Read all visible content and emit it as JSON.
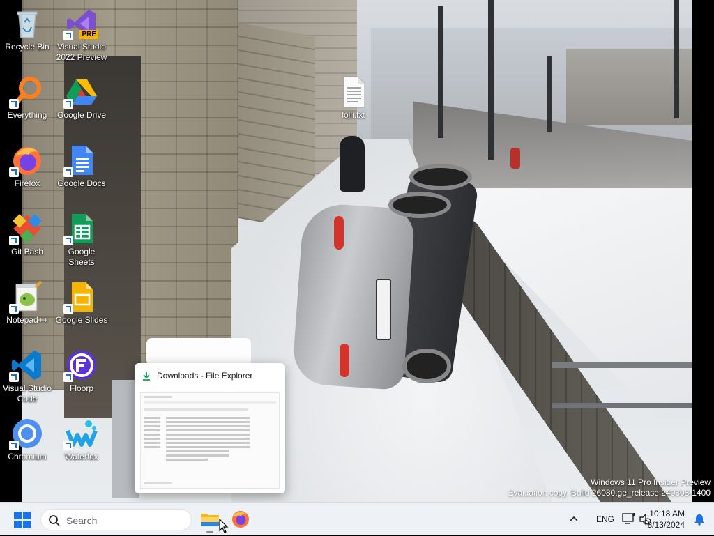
{
  "desktop": {
    "icons": [
      {
        "label": "Recycle Bin"
      },
      {
        "label": "Visual Studio 2022 Preview",
        "badge": "PRE"
      },
      {
        "label": "Everything"
      },
      {
        "label": "Google Drive"
      },
      {
        "label": "Firefox"
      },
      {
        "label": "Google Docs"
      },
      {
        "label": "Git Bash"
      },
      {
        "label": "Google Sheets"
      },
      {
        "label": "Notepad++"
      },
      {
        "label": "Google Slides"
      },
      {
        "label": "Visual Studio Code"
      },
      {
        "label": "Floorp"
      },
      {
        "label": "Chromium"
      },
      {
        "label": "Waterfox"
      },
      {
        "label": "lolli.txt"
      }
    ]
  },
  "preview": {
    "title": "Downloads - File Explorer"
  },
  "watermark": {
    "line1": "Windows 11 Pro Insider Preview",
    "line2": "Evaluation copy. Build 26080.ge_release.240308-1400"
  },
  "taskbar": {
    "search_label": "Search",
    "apps": [
      "file-explorer",
      "firefox"
    ],
    "language": "ENG",
    "time": "10:18 AM",
    "date": "8/13/2024"
  },
  "colors": {
    "taskbar_bg": "#eef1f6",
    "accent": "#1a73e8"
  }
}
